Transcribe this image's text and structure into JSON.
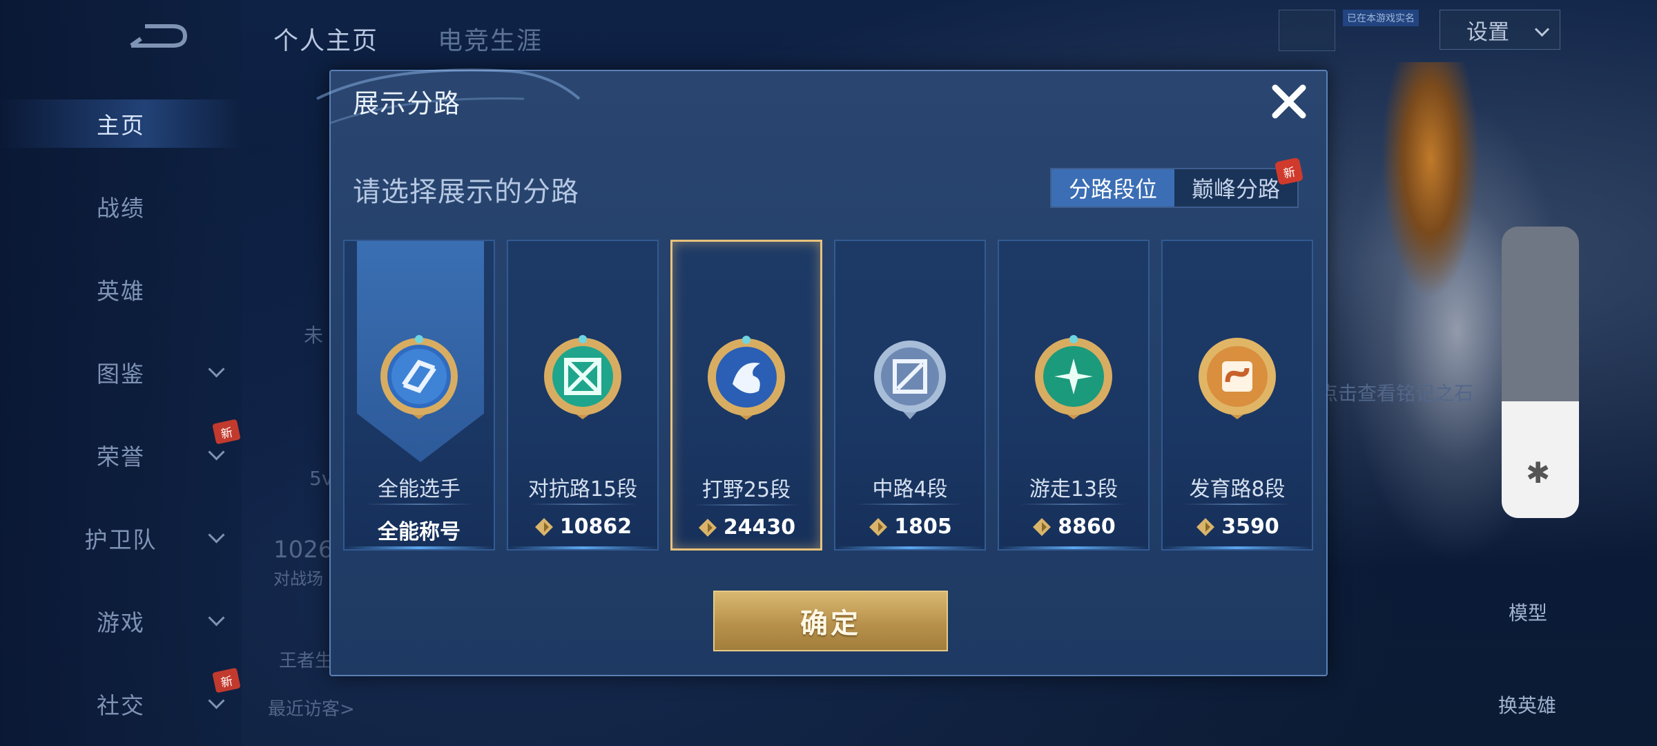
{
  "nav": {
    "items": [
      {
        "label": "主页",
        "active": true
      },
      {
        "label": "战绩"
      },
      {
        "label": "英雄"
      },
      {
        "label": "图鉴"
      },
      {
        "label": "荣誉",
        "badge": "新"
      },
      {
        "label": "护卫队"
      },
      {
        "label": "游戏"
      },
      {
        "label": "社交",
        "badge": "新"
      }
    ]
  },
  "top_tabs": [
    {
      "label": "个人主页",
      "active": true
    },
    {
      "label": "电竞生涯"
    }
  ],
  "header": {
    "settings_label": "设置",
    "mini_tag": "已在本游戏实名"
  },
  "background": {
    "partial_1": "未",
    "partial_2": "5v",
    "partial_3": "1026",
    "partial_4": "对战场",
    "partial_5": "王者生",
    "recent_visitors": "最近访客>",
    "stone_hint": "点击查看铭记之石",
    "model_label": "模型",
    "switch_hero_label": "换英雄"
  },
  "dialog": {
    "title": "展示分路",
    "subtitle": "请选择展示的分路",
    "segment": [
      {
        "label": "分路段位",
        "active": true
      },
      {
        "label": "巅峰分路",
        "badge": "新"
      }
    ],
    "cards": [
      {
        "lane": "全能选手",
        "score_text": "全能称号",
        "icon": "all-round-emblem",
        "selected": false
      },
      {
        "lane": "对抗路15段",
        "score_text": "10862",
        "icon": "clash-lane-emblem",
        "selected": false
      },
      {
        "lane": "打野25段",
        "score_text": "24430",
        "icon": "jungle-emblem",
        "selected": true
      },
      {
        "lane": "中路4段",
        "score_text": "1805",
        "icon": "mid-lane-emblem",
        "selected": false
      },
      {
        "lane": "游走13段",
        "score_text": "8860",
        "icon": "roam-emblem",
        "selected": false
      },
      {
        "lane": "发育路8段",
        "score_text": "3590",
        "icon": "farm-lane-emblem",
        "selected": false
      }
    ],
    "confirm_label": "确定"
  },
  "colors": {
    "accent_gold": "#e8c27c",
    "segment_active": "#3b6eb4",
    "dialog_bg": "#23406a",
    "badge_red": "#c23a2e"
  }
}
